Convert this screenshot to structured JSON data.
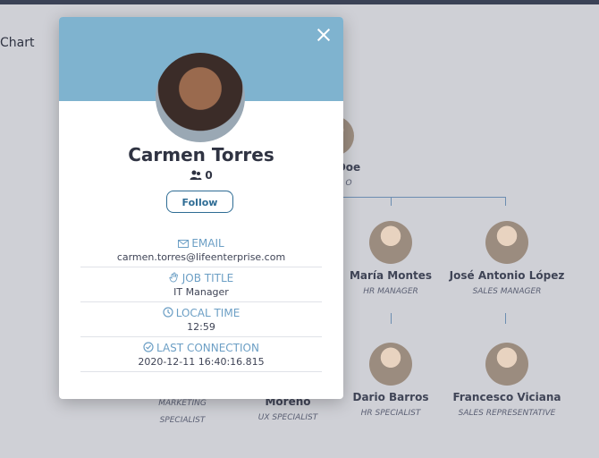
{
  "page": {
    "title": "Chart"
  },
  "org_chart": {
    "top": {
      "name_fragment": "Doe",
      "role_fragment": "O"
    },
    "managers": [
      {
        "name": "María Montes",
        "role": "HR MANAGER"
      },
      {
        "name": "José Antonio López",
        "role": "SALES MANAGER"
      }
    ],
    "staff": [
      {
        "name": "",
        "role": "MARKETING SPECIALIST"
      },
      {
        "name": "Moreno",
        "role": "UX SPECIALIST"
      },
      {
        "name": "Dario Barros",
        "role": "HR SPECIALIST"
      },
      {
        "name": "Francesco Viciana",
        "role": "SALES REPRESENTATIVE"
      }
    ]
  },
  "profile": {
    "name": "Carmen Torres",
    "followers_count": "0",
    "follow_label": "Follow",
    "email_label": "EMAIL",
    "email": "carmen.torres@lifeenterprise.com",
    "job_title_label": "JOB TITLE",
    "job_title": "IT Manager",
    "local_time_label": "LOCAL TIME",
    "local_time": "12:59",
    "last_connection_label": "LAST CONNECTION",
    "last_connection": "2020-12-11 16:40:16.815"
  },
  "colors": {
    "header": "#7fb3cf",
    "accent": "#2e6c94",
    "label": "#6c9fc5",
    "backdrop": "#cfd0d6"
  },
  "icons": {
    "close": "close-icon",
    "followers": "users-icon",
    "email": "envelope-icon",
    "job_title": "hand-icon",
    "local_time": "clock-icon",
    "last_connection": "check-circle-icon"
  }
}
